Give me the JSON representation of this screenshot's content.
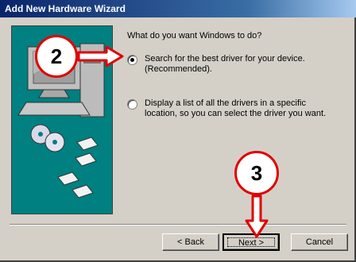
{
  "window": {
    "title": "Add New Hardware Wizard"
  },
  "prompt": "What do you want Windows to do?",
  "options": [
    {
      "line1": "Search for the best driver for your device.",
      "line2": "(Recommended).",
      "selected": true
    },
    {
      "line1": "Display a list of all the drivers in a specific",
      "line2": "location, so you can select the driver you want.",
      "selected": false
    }
  ],
  "buttons": {
    "back": "< Back",
    "next": "Next >",
    "cancel": "Cancel"
  },
  "callouts": {
    "step2": "2",
    "step3": "3"
  },
  "colors": {
    "callout_red": "#e00000",
    "art_teal": "#008080"
  }
}
